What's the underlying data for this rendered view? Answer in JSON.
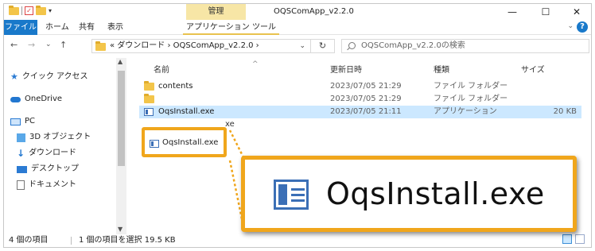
{
  "titlebar": {
    "manage_label": "管理",
    "window_title": "OQSComApp_v2.2.0",
    "minimize_label": "—",
    "maximize_label": "☐",
    "close_label": "✕"
  },
  "ribbon": {
    "tabs": [
      "ファイル",
      "ホーム",
      "共有",
      "表示",
      "アプリケーション ツール"
    ]
  },
  "address": {
    "back": "←",
    "forward": "→",
    "recent": "⌄",
    "up": "↑",
    "path": "« ダウンロード › OQSComApp_v2.2.0 ›",
    "dropdown": "⌄",
    "refresh": "↻",
    "search_placeholder": "OQSComApp_v2.2.0の検索"
  },
  "navpane": {
    "items": [
      {
        "label": "クイック アクセス",
        "icon": "star-icon"
      },
      {
        "label": "OneDrive",
        "icon": "cloud-icon"
      },
      {
        "label": "PC",
        "icon": "pc-icon"
      },
      {
        "label": "3D オブジェクト",
        "icon": "cube-icon"
      },
      {
        "label": "ダウンロード",
        "icon": "download-icon"
      },
      {
        "label": "デスクトップ",
        "icon": "desktop-icon"
      },
      {
        "label": "ドキュメント",
        "icon": "document-icon"
      }
    ]
  },
  "columns": {
    "name": "名前",
    "modified": "更新日時",
    "type": "種類",
    "size": "サイズ"
  },
  "files": [
    {
      "name": "contents",
      "modified": "2023/07/05 21:29",
      "type": "ファイル フォルダー",
      "size": ""
    },
    {
      "name": "",
      "modified": "2023/07/05 21:29",
      "type": "ファイル フォルダー",
      "size": ""
    },
    {
      "name": "OqsInstall.exe",
      "modified": "2023/07/05 21:11",
      "type": "アプリケーション",
      "size": "20 KB"
    },
    {
      "name": "xe",
      "modified": "",
      "type": "",
      "size": ""
    }
  ],
  "status": {
    "item_count": "4 個の項目",
    "selection": "1 個の項目を選択  19.5 KB"
  },
  "callout": {
    "small_label": "OqsInstall.exe",
    "big_label": "OqsInstall.exe"
  },
  "colors": {
    "accent": "#1979ca",
    "highlight": "#f0a61c",
    "selected_row": "#cce8ff",
    "manage_tab": "#f7e6a6"
  }
}
